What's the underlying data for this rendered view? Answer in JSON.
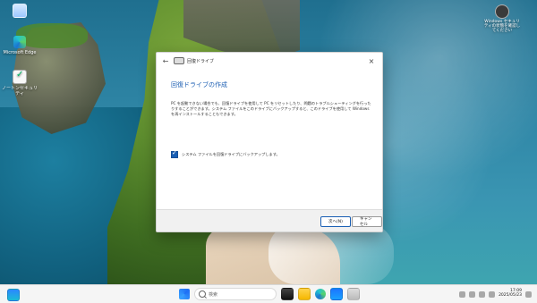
{
  "desktop": {
    "icons": [
      {
        "label": ""
      },
      {
        "label": "Microsoft Edge"
      },
      {
        "label": "ノートンセキュリティ"
      }
    ],
    "top_right_icon": {
      "label": "Windows セキュリティの状態を確認してください"
    }
  },
  "dialog": {
    "title": "回復ドライブ",
    "heading": "回復ドライブの作成",
    "description": "PC を起動できない場合でも、回復ドライブを使用して PC をリセットしたり、問題のトラブルシューティングを行ったりすることができます。システム ファイルをこのドライブにバックアップすると、このドライブを使用して Windows を再インストールすることもできます。",
    "checkbox_label": "システム ファイルを回復ドライブにバックアップします。",
    "checkbox_checked": true,
    "buttons": {
      "next": "次へ(N)",
      "cancel": "キャンセル"
    }
  },
  "taskbar": {
    "search_placeholder": "検索",
    "time": "17:09",
    "date": "2025/05/23"
  },
  "colors": {
    "accent": "#1a5fb4",
    "heading": "#1d5fb3"
  }
}
